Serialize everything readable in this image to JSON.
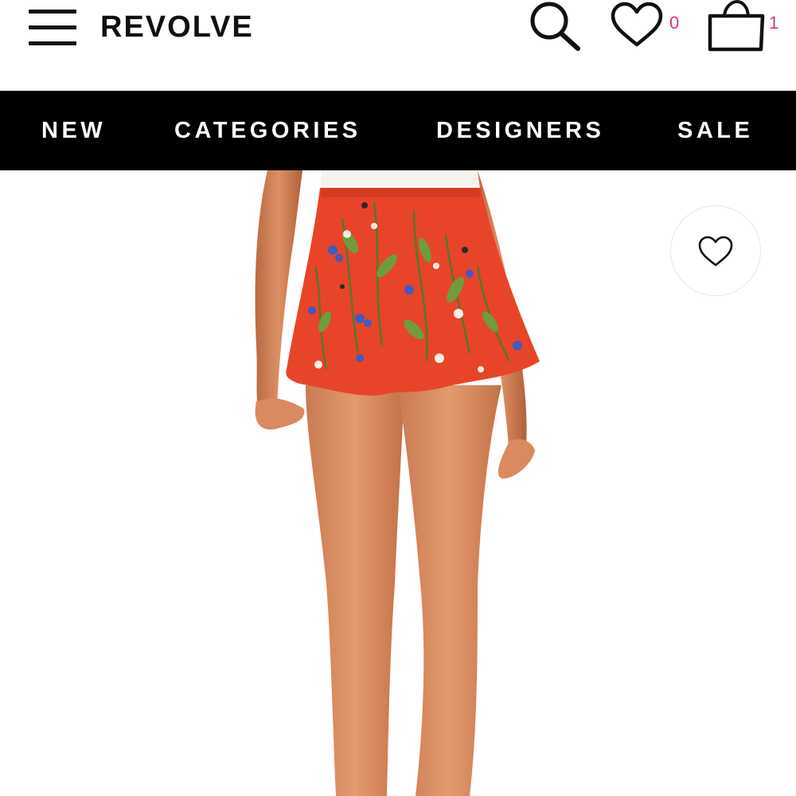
{
  "header": {
    "logo": "REVOLVE",
    "menu_icon": "hamburger-menu-icon",
    "search_icon": "search-icon",
    "wishlist_icon": "heart-icon",
    "wishlist_count": "0",
    "bag_icon": "shopping-bag-icon",
    "bag_count": "1"
  },
  "nav": {
    "items": [
      {
        "label": "NEW"
      },
      {
        "label": "CATEGORIES"
      },
      {
        "label": "DESIGNERS"
      },
      {
        "label": "SALE"
      }
    ]
  },
  "product": {
    "favorite_icon": "heart-outline-icon"
  },
  "colors": {
    "navbar_bg": "#000000",
    "count_accent": "#d63384",
    "shorts_red": "#e8442a"
  }
}
